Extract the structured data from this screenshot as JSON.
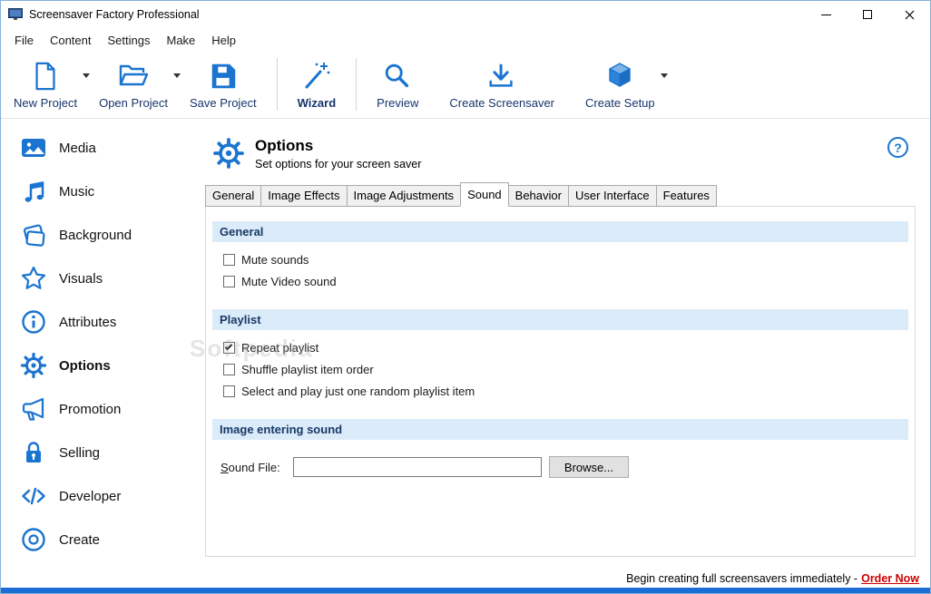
{
  "window": {
    "title": "Screensaver Factory Professional"
  },
  "menu": {
    "items": [
      {
        "label": "File"
      },
      {
        "label": "Content"
      },
      {
        "label": "Settings"
      },
      {
        "label": "Make"
      },
      {
        "label": "Help"
      }
    ]
  },
  "toolbar": {
    "items": [
      {
        "label": "New Project",
        "icon": "new-document-icon",
        "has_dropdown": true
      },
      {
        "label": "Open Project",
        "icon": "open-folder-icon",
        "has_dropdown": true
      },
      {
        "label": "Save Project",
        "icon": "save-floppy-icon",
        "has_dropdown": false
      },
      {
        "label": "Wizard",
        "icon": "magic-wand-icon",
        "has_dropdown": false
      },
      {
        "label": "Preview",
        "icon": "magnifier-icon",
        "has_dropdown": false
      },
      {
        "label": "Create Screensaver",
        "icon": "download-arrow-icon",
        "has_dropdown": false
      },
      {
        "label": "Create Setup",
        "icon": "package-box-icon",
        "has_dropdown": true
      }
    ]
  },
  "sidebar": {
    "items": [
      {
        "label": "Media",
        "icon": "media-image-icon",
        "active": false
      },
      {
        "label": "Music",
        "icon": "music-note-icon",
        "active": false
      },
      {
        "label": "Background",
        "icon": "background-layers-icon",
        "active": false
      },
      {
        "label": "Visuals",
        "icon": "star-icon",
        "active": false
      },
      {
        "label": "Attributes",
        "icon": "info-icon",
        "active": false
      },
      {
        "label": "Options",
        "icon": "gear-icon",
        "active": true
      },
      {
        "label": "Promotion",
        "icon": "megaphone-icon",
        "active": false
      },
      {
        "label": "Selling",
        "icon": "lock-icon",
        "active": false
      },
      {
        "label": "Developer",
        "icon": "code-icon",
        "active": false
      },
      {
        "label": "Create",
        "icon": "disc-icon",
        "active": false
      }
    ]
  },
  "page": {
    "title": "Options",
    "subtitle": "Set options for your screen saver",
    "help_glyph": "?"
  },
  "tabs": [
    {
      "label": "General",
      "active": false
    },
    {
      "label": "Image Effects",
      "active": false
    },
    {
      "label": "Image Adjustments",
      "active": false
    },
    {
      "label": "Sound",
      "active": true
    },
    {
      "label": "Behavior",
      "active": false
    },
    {
      "label": "User Interface",
      "active": false
    },
    {
      "label": "Features",
      "active": false
    }
  ],
  "sound_tab": {
    "general": {
      "title": "General",
      "checkboxes": [
        {
          "label": "Mute sounds",
          "checked": false
        },
        {
          "label": "Mute Video sound",
          "checked": false
        }
      ]
    },
    "playlist": {
      "title": "Playlist",
      "checkboxes": [
        {
          "label": "Repeat playlist",
          "checked": true
        },
        {
          "label": "Shuffle playlist item order",
          "checked": false
        },
        {
          "label": "Select and play just one random playlist item",
          "checked": false
        }
      ]
    },
    "image_sound": {
      "title": "Image entering sound",
      "file_label_key": "S",
      "file_label_rest": "ound File:",
      "file_value": "",
      "browse_label": "Browse..."
    }
  },
  "statusbar": {
    "text": "Begin creating full screensavers immediately -",
    "link": "Order Now"
  },
  "watermark": {
    "text": "Softpedia"
  },
  "colors": {
    "accent_blue": "#1b74d0",
    "section_header_bg": "#dcebf9",
    "order_now_red": "#cc0000",
    "bottom_strip_blue": "#1a6fd4"
  }
}
